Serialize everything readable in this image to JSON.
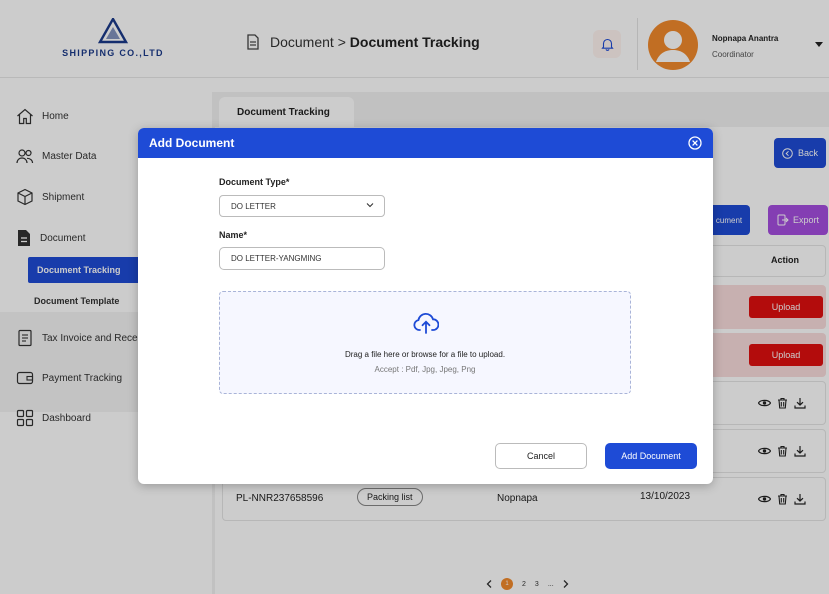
{
  "brand": {
    "company": "SHIPPING CO.,LTD"
  },
  "header": {
    "breadcrumb_parent": "Document",
    "breadcrumb_sep": ">",
    "breadcrumb_current": "Document Tracking"
  },
  "user": {
    "name": "Nopnapa Anantra",
    "role": "Coordinator"
  },
  "sidebar": {
    "items": [
      {
        "label": "Home",
        "icon": "home-icon"
      },
      {
        "label": "Master Data",
        "icon": "users-icon"
      },
      {
        "label": "Shipment",
        "icon": "box-icon"
      },
      {
        "label": "Document",
        "icon": "document-icon"
      },
      {
        "label": "Tax Invoice and Receipt",
        "icon": "invoice-icon"
      },
      {
        "label": "Payment Tracking",
        "icon": "wallet-icon"
      },
      {
        "label": "Dashboard",
        "icon": "dashboard-icon"
      }
    ],
    "sub_items": [
      "Document Tracking",
      "Document Template"
    ]
  },
  "main": {
    "tab": "Document Tracking",
    "back_label": "Back",
    "add_doc_partial": "cument",
    "export_label": "Export",
    "action_header": "Action",
    "upload_label": "Upload",
    "last_row": {
      "doc_no": "PL-NNR237658596",
      "type": "Packing list",
      "owner": "Nopnapa",
      "date": "13/10/2023"
    },
    "pager": [
      "1",
      "2",
      "3",
      "..."
    ]
  },
  "modal": {
    "title": "Add Document",
    "doc_type_label": "Document Type*",
    "doc_type_value": "DO LETTER",
    "name_label": "Name*",
    "name_value": "DO LETTER-YANGMING",
    "dropzone_main": "Drag a file here or browse for a file to upload.",
    "dropzone_sub": "Accept : Pdf, Jpg, Jpeg, Png",
    "cancel_label": "Cancel",
    "submit_label": "Add Document"
  },
  "colors": {
    "primary": "#1e4bd6",
    "danger": "#e01010",
    "export": "#a64ee0",
    "avatar": "#f28a2c",
    "row_alert": "#f9dcdc"
  }
}
